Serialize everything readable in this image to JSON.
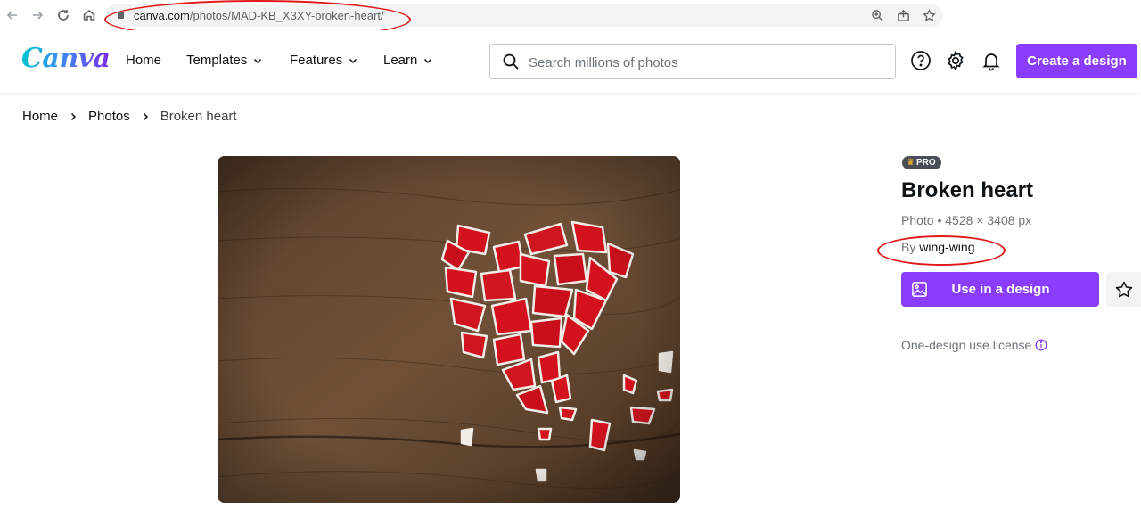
{
  "browser": {
    "url_host": "canva.com",
    "url_path": "/photos/MAD-KB_X3XY-broken-heart/",
    "icons": [
      "back-icon",
      "forward-icon",
      "reload-icon",
      "home-icon",
      "zoom-icon",
      "share-icon",
      "bookmark-star-icon"
    ]
  },
  "header": {
    "logo": "Canva",
    "nav": [
      {
        "label": "Home"
      },
      {
        "label": "Templates"
      },
      {
        "label": "Features"
      },
      {
        "label": "Learn"
      }
    ],
    "search_placeholder": "Search millions of photos",
    "create_button": "Create a design",
    "icons": [
      "help-icon",
      "settings-icon",
      "notifications-icon"
    ]
  },
  "breadcrumb": [
    "Home",
    "Photos",
    "Broken heart"
  ],
  "photo": {
    "badge": "PRO",
    "title": "Broken heart",
    "meta": "Photo • 4528 × 3408 px",
    "by_prefix": "By",
    "author": "wing-wing",
    "use_button": "Use in a design",
    "license": "One-design use license"
  },
  "colors": {
    "accent": "#8b3dff",
    "annotation": "#e01a1a",
    "heart_red": "#d4121e"
  }
}
